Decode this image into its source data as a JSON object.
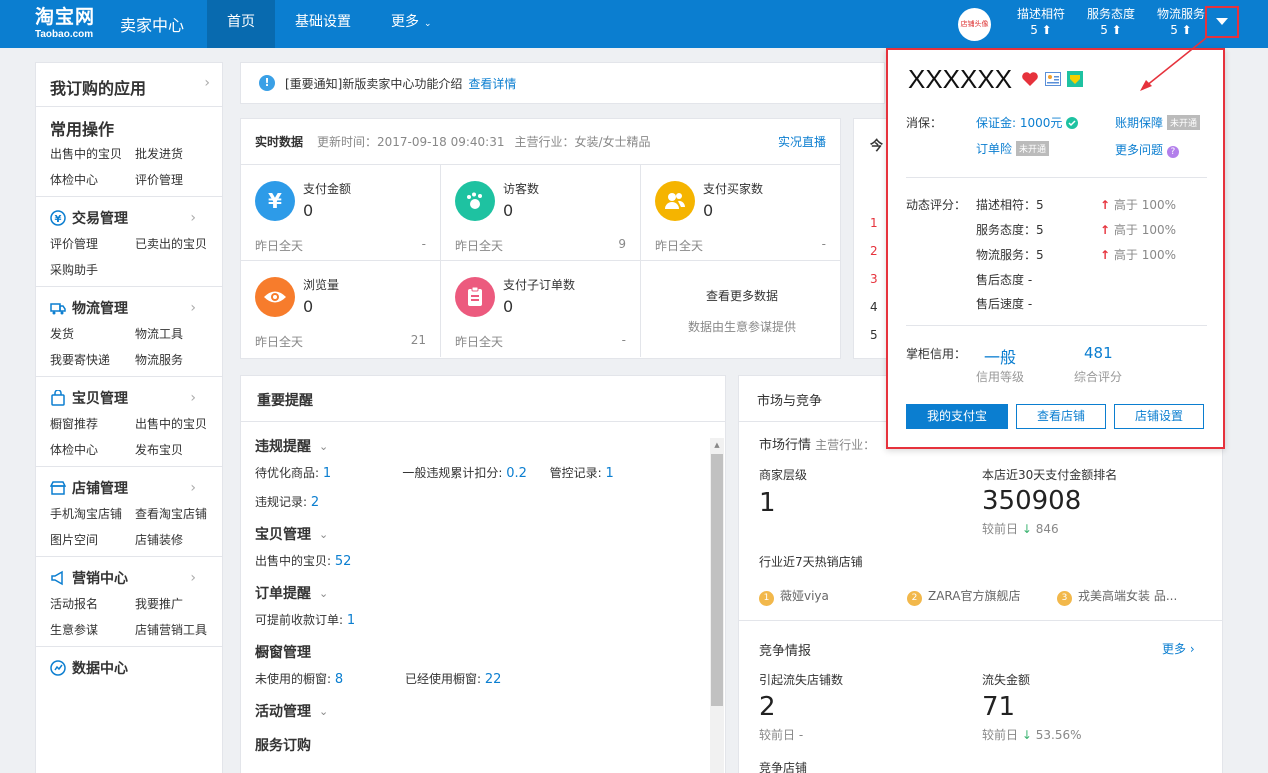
{
  "topbar": {
    "logo_cn": "淘宝网",
    "logo_en": "Taobao.com",
    "seller_center": "卖家中心",
    "nav": [
      {
        "label": "首页",
        "active": true
      },
      {
        "label": "基础设置",
        "active": false
      },
      {
        "label": "更多",
        "active": false
      }
    ],
    "avatar_text": "店铺头像",
    "scores": [
      {
        "label": "描述相符",
        "value": "5 ⬆"
      },
      {
        "label": "服务态度",
        "value": "5 ⬆"
      },
      {
        "label": "物流服务",
        "value": "5 ⬆"
      }
    ],
    "dropdown_icon": "caret-down-icon"
  },
  "sidebar": {
    "title": "我订购的应用",
    "common": {
      "title": "常用操作",
      "items": [
        "出售中的宝贝",
        "批发进货",
        "体检中心",
        "评价管理"
      ]
    },
    "sections": [
      {
        "title": "交易管理",
        "icon": "yen-icon",
        "items": [
          "评价管理",
          "已卖出的宝贝",
          "采购助手"
        ]
      },
      {
        "title": "物流管理",
        "icon": "truck-icon",
        "items": [
          "发货",
          "物流工具",
          "我要寄快递",
          "物流服务"
        ]
      },
      {
        "title": "宝贝管理",
        "icon": "bag-icon",
        "items": [
          "橱窗推荐",
          "出售中的宝贝",
          "体检中心",
          "发布宝贝"
        ]
      },
      {
        "title": "店铺管理",
        "icon": "shop-icon",
        "items": [
          "手机淘宝店铺",
          "查看淘宝店铺",
          "图片空间",
          "店铺装修"
        ]
      },
      {
        "title": "营销中心",
        "icon": "megaphone-icon",
        "items": [
          "活动报名",
          "我要推广",
          "生意参谋",
          "店铺营销工具"
        ]
      },
      {
        "title": "数据中心",
        "icon": "data-icon",
        "items": []
      }
    ]
  },
  "notice": {
    "text": "[重要通知]新版卖家中心功能介绍",
    "link": "查看详情"
  },
  "realtime": {
    "title": "实时数据",
    "updated": "更新时间：2017-09-18 09:40:31",
    "industry": "主营行业：女装/女士精品",
    "live": "实况直播",
    "cells": [
      {
        "label": "支付金额",
        "value": "0",
        "yesterday_label": "昨日全天",
        "yesterday": "-",
        "icon": "yen-icon",
        "color": "#2d9be8"
      },
      {
        "label": "访客数",
        "value": "0",
        "yesterday_label": "昨日全天",
        "yesterday": "9",
        "icon": "footprint-icon",
        "color": "#1ec2a1"
      },
      {
        "label": "支付买家数",
        "value": "0",
        "yesterday_label": "昨日全天",
        "yesterday": "-",
        "icon": "users-icon",
        "color": "#f5b400"
      },
      {
        "label": "浏览量",
        "value": "0",
        "yesterday_label": "昨日全天",
        "yesterday": "21",
        "icon": "eye-icon",
        "color": "#f77c2c"
      },
      {
        "label": "支付子订单数",
        "value": "0",
        "yesterday_label": "昨日全天",
        "yesterday": "-",
        "icon": "list-icon",
        "color": "#ec5a7e"
      }
    ],
    "more_title": "查看更多数据",
    "more_sub": "数据由生意参谋提供"
  },
  "today": {
    "title": "今",
    "nums": [
      "1",
      "2",
      "3",
      "4",
      "5"
    ]
  },
  "reminders": {
    "title": "重要提醒",
    "violation": {
      "title": "违规提醒",
      "opt_label": "待优化商品:",
      "opt": "1",
      "deduct_label": "一般违规累计扣分:",
      "deduct": "0.2",
      "control_label": "管控记录:",
      "control": "1",
      "record_label": "违规记录:",
      "record": "2"
    },
    "items": {
      "title": "宝贝管理",
      "selling_label": "出售中的宝贝:",
      "selling": "52"
    },
    "orders": {
      "title": "订单提醒",
      "early_label": "可提前收款订单:",
      "early": "1"
    },
    "window": {
      "title": "橱窗管理",
      "unused_label": "未使用的橱窗:",
      "unused": "8",
      "used_label": "已经使用橱窗:",
      "used": "22"
    },
    "activity": {
      "title": "活动管理"
    },
    "service": {
      "title": "服务订购"
    }
  },
  "market": {
    "title": "市场与竞争",
    "trend_title": "市场行情",
    "trend_industry": "主营行业：",
    "tier_label": "商家层级",
    "tier": "1",
    "rank_label": "本店近30天支付金额排名",
    "rank": "350908",
    "rank_cmp_label": "较前日",
    "rank_cmp": "846",
    "hot_title": "行业近7天热销店铺",
    "hot_shops": [
      "薇娅viya",
      "ZARA官方旗舰店",
      "戎美高端女装 品..."
    ],
    "compete_title": "竞争情报",
    "more": "更多",
    "lost_shops_label": "引起流失店铺数",
    "lost_shops": "2",
    "lost_shops_cmp_label": "较前日",
    "lost_shops_cmp": "-",
    "lost_amount_label": "流失金额",
    "lost_amount": "71",
    "lost_amount_cmp_label": "较前日",
    "lost_amount_cmp": "53.56%",
    "compete_shops": "竞争店铺"
  },
  "popup": {
    "name": "XXXXXX",
    "consumer_label": "消保：",
    "deposit": "保证金: 1000元",
    "account_guard": "账期保障",
    "not_open": "未开通",
    "order_insurance": "订单险",
    "more_questions": "更多问题",
    "dynamic_label": "动态评分：",
    "ratings": [
      {
        "label": "描述相符：5",
        "cmp": "高于 100%"
      },
      {
        "label": "服务态度：5",
        "cmp": "高于 100%"
      },
      {
        "label": "物流服务：5",
        "cmp": "高于 100%"
      },
      {
        "label": "售后态度 -",
        "cmp": ""
      },
      {
        "label": "售后速度 -",
        "cmp": ""
      }
    ],
    "credit_label": "掌柜信用：",
    "credit_level": "一般",
    "credit_level_label": "信用等级",
    "score": "481",
    "score_label": "综合评分",
    "buttons": [
      "我的支付宝",
      "查看店铺",
      "店铺设置"
    ]
  }
}
